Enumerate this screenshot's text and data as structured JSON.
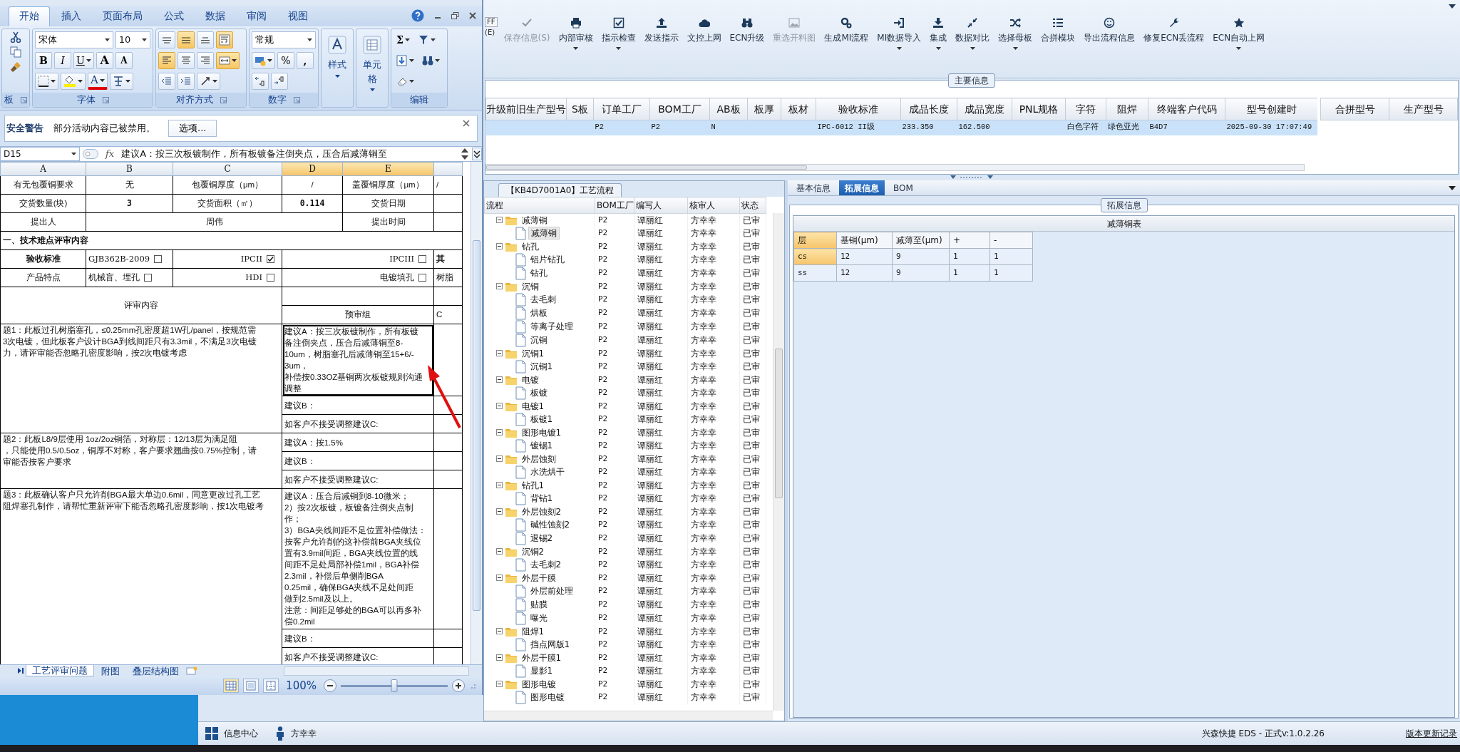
{
  "excel": {
    "tabs": [
      {
        "label": "开始",
        "selected": true
      },
      {
        "label": "插入",
        "selected": false
      },
      {
        "label": "页面布局",
        "selected": false
      },
      {
        "label": "公式",
        "selected": false
      },
      {
        "label": "数据",
        "selected": false
      },
      {
        "label": "审阅",
        "selected": false
      },
      {
        "label": "视图",
        "selected": false
      }
    ],
    "ribbon": {
      "clipboard": {
        "label": "板"
      },
      "font": {
        "label": "字体",
        "font_name": "宋体",
        "font_size": "10",
        "bold": "B",
        "italic": "I",
        "underline": "U",
        "grow": "A",
        "shrink": "A",
        "font_color": "A"
      },
      "alignment": {
        "label": "对齐方式",
        "buttons": [
          {
            "kind": "top",
            "selected": false
          },
          {
            "kind": "middle",
            "selected": true
          },
          {
            "kind": "bottom",
            "selected": false
          },
          {
            "kind": "wrap",
            "selected": true
          },
          {
            "kind": "left",
            "selected": true
          },
          {
            "kind": "center",
            "selected": false
          },
          {
            "kind": "right",
            "selected": false
          },
          {
            "kind": "merge",
            "selected": true
          },
          {
            "kind": "outdent",
            "selected": false
          },
          {
            "kind": "indent",
            "selected": false
          },
          {
            "kind": "orientation",
            "selected": false
          }
        ]
      },
      "number": {
        "label": "数字",
        "format": "常规",
        "percent": "%",
        "comma": ","
      },
      "styles": {
        "label": "样式"
      },
      "cells": {
        "label": "单元格"
      },
      "editing": {
        "label": "编辑",
        "sum": "Σ"
      }
    },
    "security_bar": {
      "title": "安全警告",
      "message": "部分活动内容已被禁用。",
      "button": "选项..."
    },
    "name_box": "D15",
    "fx": "fx",
    "formula": "建议A：按三次板镀制作，所有板镀备注倒夹点，压合后减薄铜至",
    "columns": [
      {
        "label": "A",
        "selected": false
      },
      {
        "label": "B",
        "selected": false
      },
      {
        "label": "C",
        "selected": false
      },
      {
        "label": "D",
        "selected": true
      },
      {
        "label": "E",
        "selected": true
      }
    ],
    "rows": [
      {
        "kind": "info",
        "bold_values": false,
        "cells": [
          "有无包覆铜要求",
          "无",
          "包覆铜厚度（μm）",
          "/",
          "盖覆铜厚度（μm）",
          "/"
        ]
      },
      {
        "kind": "info",
        "bold_values": true,
        "cells": [
          "交货数量(块)",
          "3",
          "交货面积（㎡）",
          "0.114",
          "交货日期"
        ]
      },
      {
        "kind": "person",
        "cells": [
          "提出人",
          "周伟",
          "提出时间"
        ]
      },
      {
        "kind": "section",
        "text": "一、技术难点评审内容"
      },
      {
        "kind": "options",
        "label": "验收标准",
        "bold": true,
        "options": [
          {
            "text": "GJB362B-2009",
            "checked": false
          },
          {
            "text": "IPCII",
            "checked": true
          },
          {
            "text": "IPCIII",
            "checked": false
          }
        ],
        "extra": "其"
      },
      {
        "kind": "options",
        "label": "产品特点",
        "bold": false,
        "options": [
          {
            "text": "机械盲、埋孔",
            "checked": false
          },
          {
            "text": "HDI",
            "checked": false
          },
          {
            "text": "电镀填孔",
            "checked": false
          }
        ],
        "extra": "树脂"
      },
      {
        "kind": "review_header",
        "left": "评审内容",
        "group": "预审组",
        "extra": "C"
      },
      {
        "kind": "issue",
        "issue_lines": [
          "题1：此板过孔树脂塞孔，≤0.25mm孔密度超1W孔/panel，按规范需",
          "3次电镀，但此板客户设计BGA到线间距只有3.3mil，不满足3次电镀",
          "力，请评审能否忽略孔密度影响，按2次电镀考虑"
        ],
        "suggestions": [
          {
            "selected": true,
            "lines": [
              "建议A：按三次板镀制作，所有板镀",
              "备注倒夹点，压合后减薄铜至8-",
              "10um，树脂塞孔后减薄铜至15+6/-",
              "3um，",
              "补偿按0.33OZ基铜两次板镀规则沟通",
              "调整"
            ]
          },
          {
            "selected": false,
            "lines": [
              "建议B："
            ]
          },
          {
            "selected": false,
            "lines": [
              "如客户不接受调整建议C:"
            ]
          }
        ]
      },
      {
        "kind": "issue",
        "issue_lines": [
          "题2：此板L8/9层使用 1oz/2oz铜箔，对称层：12/13层为满足阻",
          "，只能使用0.5/0.5oz，铜厚不对称，客户要求翘曲按0.75%控制，请",
          "审能否按客户要求"
        ],
        "suggestions": [
          {
            "selected": false,
            "lines": [
              "建议A：按1.5%"
            ]
          },
          {
            "selected": false,
            "lines": [
              "建议B："
            ]
          },
          {
            "selected": false,
            "lines": [
              "如客户不接受调整建议C:"
            ]
          }
        ]
      },
      {
        "kind": "issue",
        "issue_lines": [
          "题3：此板确认客户只允许削BGA最大单边0.6mil，同意更改过孔工艺",
          "阻焊塞孔制作，请帮忙重新评审下能否忽略孔密度影响，按1次电镀考"
        ],
        "suggestions": [
          {
            "selected": false,
            "lines": [
              "建议A：压合后减铜到8-10微米；",
              "2）按2次板镀，板镀备注倒夹点制",
              "作；",
              "3）BGA夹线间距不足位置补偿做法：",
              "按客户允许削的这补偿前BGA夹线位",
              "置有3.9mil间距，BGA夹线位置的线",
              "间距不足处局部补偿1mil，BGA补偿",
              "2.3mil，补偿后单侧削BGA",
              "0.25mil，确保BGA夹线不足处间距",
              "做到2.5mil及以上。",
              "注意：间距足够处的BGA可以再多补",
              "偿0.2mil"
            ]
          },
          {
            "selected": false,
            "lines": [
              "建议B："
            ]
          },
          {
            "selected": false,
            "lines": [
              "如客户不接受调整建议C:"
            ]
          }
        ]
      }
    ],
    "sheet_tabs": [
      {
        "label": "工艺评审问题",
        "selected": true
      },
      {
        "label": "附图",
        "selected": false
      },
      {
        "label": "叠层结构图",
        "selected": false
      }
    ],
    "zoom": {
      "label": "100%",
      "level": 0.5
    }
  },
  "toolbar": {
    "partial_button": [
      "FF",
      "(E)"
    ],
    "buttons": [
      {
        "label": "保存信息(S)",
        "disabled": true,
        "dropdown": false
      },
      {
        "label": "内部审核",
        "disabled": false,
        "dropdown": true
      },
      {
        "label": "指示检查",
        "disabled": false,
        "dropdown": true
      },
      {
        "label": "发送指示",
        "disabled": false,
        "dropdown": false
      },
      {
        "label": "文控上网",
        "disabled": false,
        "dropdown": false
      },
      {
        "label": "ECN升级",
        "disabled": false,
        "dropdown": false
      },
      {
        "label": "重选开料图",
        "disabled": true,
        "dropdown": false
      },
      {
        "label": "生成MI流程",
        "disabled": false,
        "dropdown": false
      },
      {
        "label": "MI数据导入",
        "disabled": false,
        "dropdown": true
      },
      {
        "label": "集成",
        "disabled": false,
        "dropdown": true
      },
      {
        "label": "数据对比",
        "disabled": false,
        "dropdown": true
      },
      {
        "label": "选择母板",
        "disabled": false,
        "dropdown": true
      },
      {
        "label": "合拼模块",
        "disabled": false,
        "dropdown": false
      },
      {
        "label": "导出流程信息",
        "disabled": false,
        "dropdown": false
      },
      {
        "label": "修复ECN丢流程",
        "disabled": false,
        "dropdown": false
      },
      {
        "label": "ECN自动上网",
        "disabled": false,
        "dropdown": true
      }
    ]
  },
  "main_info": {
    "title": "主要信息",
    "columns": [
      "升级前旧生产型号",
      "S板",
      "订单工厂",
      "BOM工厂",
      "AB板",
      "板厚",
      "板材",
      "验收标准",
      "成品长度",
      "成品宽度",
      "PNL规格",
      "字符",
      "阻焊",
      "终端客户代码",
      "型号创建时"
    ],
    "rows": [
      {
        "selected": true,
        "cells": [
          null,
          null,
          "P2",
          "P2",
          "N",
          null,
          null,
          "IPC-6012 II级",
          "233.350",
          "162.500",
          null,
          "白色字符",
          "绿色亚光",
          "B4D7",
          "2025-09-30 17:07:49"
        ]
      }
    ],
    "merge_columns": [
      "合拼型号",
      "生产型号"
    ]
  },
  "process": {
    "title": "【KB4D7001A0】工艺流程",
    "columns": [
      "流程",
      "BOM工厂",
      "编写人",
      "核审人",
      "状态"
    ],
    "items": [
      {
        "name": "减薄铜",
        "bom": "P2",
        "writer": "谭丽红",
        "reviewer": "方幸幸",
        "status": "已审",
        "expanded": true,
        "selected": false,
        "children": [
          {
            "name": "减薄铜",
            "bom": "P2",
            "writer": "谭丽红",
            "reviewer": "方幸幸",
            "status": "已审",
            "selected": true
          }
        ]
      },
      {
        "name": "钻孔",
        "bom": "P2",
        "writer": "谭丽红",
        "reviewer": "方幸幸",
        "status": "已审",
        "expanded": true,
        "selected": false,
        "children": [
          {
            "name": "铝片钻孔",
            "bom": "P2",
            "writer": "谭丽红",
            "reviewer": "方幸幸",
            "status": "已审",
            "selected": false
          },
          {
            "name": "钻孔",
            "bom": "P2",
            "writer": "谭丽红",
            "reviewer": "方幸幸",
            "status": "已审",
            "selected": false
          }
        ]
      },
      {
        "name": "沉铜",
        "bom": "P2",
        "writer": "谭丽红",
        "reviewer": "方幸幸",
        "status": "已审",
        "expanded": true,
        "selected": false,
        "children": [
          {
            "name": "去毛刺",
            "bom": "P2",
            "writer": "谭丽红",
            "reviewer": "方幸幸",
            "status": "已审",
            "selected": false
          },
          {
            "name": "烘板",
            "bom": "P2",
            "writer": "谭丽红",
            "reviewer": "方幸幸",
            "status": "已审",
            "selected": false
          },
          {
            "name": "等离子处理",
            "bom": "P2",
            "writer": "谭丽红",
            "reviewer": "方幸幸",
            "status": "已审",
            "selected": false
          },
          {
            "name": "沉铜",
            "bom": "P2",
            "writer": "谭丽红",
            "reviewer": "方幸幸",
            "status": "已审",
            "selected": false
          }
        ]
      },
      {
        "name": "沉铜1",
        "bom": "P2",
        "writer": "谭丽红",
        "reviewer": "方幸幸",
        "status": "已审",
        "expanded": true,
        "selected": false,
        "children": [
          {
            "name": "沉铜1",
            "bom": "P2",
            "writer": "谭丽红",
            "reviewer": "方幸幸",
            "status": "已审",
            "selected": false
          }
        ]
      },
      {
        "name": "电镀",
        "bom": "P2",
        "writer": "谭丽红",
        "reviewer": "方幸幸",
        "status": "已审",
        "expanded": true,
        "selected": false,
        "children": [
          {
            "name": "板镀",
            "bom": "P2",
            "writer": "谭丽红",
            "reviewer": "方幸幸",
            "status": "已审",
            "selected": false
          }
        ]
      },
      {
        "name": "电镀1",
        "bom": "P2",
        "writer": "谭丽红",
        "reviewer": "方幸幸",
        "status": "已审",
        "expanded": true,
        "selected": false,
        "children": [
          {
            "name": "板镀1",
            "bom": "P2",
            "writer": "谭丽红",
            "reviewer": "方幸幸",
            "status": "已审",
            "selected": false
          }
        ]
      },
      {
        "name": "图形电镀1",
        "bom": "P2",
        "writer": "谭丽红",
        "reviewer": "方幸幸",
        "status": "已审",
        "expanded": true,
        "selected": false,
        "children": [
          {
            "name": "镀锡1",
            "bom": "P2",
            "writer": "谭丽红",
            "reviewer": "方幸幸",
            "status": "已审",
            "selected": false
          }
        ]
      },
      {
        "name": "外层蚀刻",
        "bom": "P2",
        "writer": "谭丽红",
        "reviewer": "方幸幸",
        "status": "已审",
        "expanded": true,
        "selected": false,
        "children": [
          {
            "name": "水洗烘干",
            "bom": "P2",
            "writer": "谭丽红",
            "reviewer": "方幸幸",
            "status": "已审",
            "selected": false
          }
        ]
      },
      {
        "name": "钻孔1",
        "bom": "P2",
        "writer": "谭丽红",
        "reviewer": "方幸幸",
        "status": "已审",
        "expanded": true,
        "selected": false,
        "children": [
          {
            "name": "背钻1",
            "bom": "P2",
            "writer": "谭丽红",
            "reviewer": "方幸幸",
            "status": "已审",
            "selected": false
          }
        ]
      },
      {
        "name": "外层蚀刻2",
        "bom": "P2",
        "writer": "谭丽红",
        "reviewer": "方幸幸",
        "status": "已审",
        "expanded": true,
        "selected": false,
        "children": [
          {
            "name": "碱性蚀刻2",
            "bom": "P2",
            "writer": "谭丽红",
            "reviewer": "方幸幸",
            "status": "已审",
            "selected": false
          },
          {
            "name": "退锡2",
            "bom": "P2",
            "writer": "谭丽红",
            "reviewer": "方幸幸",
            "status": "已审",
            "selected": false
          }
        ]
      },
      {
        "name": "沉铜2",
        "bom": "P2",
        "writer": "谭丽红",
        "reviewer": "方幸幸",
        "status": "已审",
        "expanded": true,
        "selected": false,
        "children": [
          {
            "name": "去毛刺2",
            "bom": "P2",
            "writer": "谭丽红",
            "reviewer": "方幸幸",
            "status": "已审",
            "selected": false
          }
        ]
      },
      {
        "name": "外层干膜",
        "bom": "P2",
        "writer": "谭丽红",
        "reviewer": "方幸幸",
        "status": "已审",
        "expanded": true,
        "selected": false,
        "children": [
          {
            "name": "外层前处理",
            "bom": "P2",
            "writer": "谭丽红",
            "reviewer": "方幸幸",
            "status": "已审",
            "selected": false
          },
          {
            "name": "贴膜",
            "bom": "P2",
            "writer": "谭丽红",
            "reviewer": "方幸幸",
            "status": "已审",
            "selected": false
          },
          {
            "name": "曝光",
            "bom": "P2",
            "writer": "谭丽红",
            "reviewer": "方幸幸",
            "status": "已审",
            "selected": false
          }
        ]
      },
      {
        "name": "阻焊1",
        "bom": "P2",
        "writer": "谭丽红",
        "reviewer": "方幸幸",
        "status": "已审",
        "expanded": true,
        "selected": false,
        "children": [
          {
            "name": "挡点网版1",
            "bom": "P2",
            "writer": "谭丽红",
            "reviewer": "方幸幸",
            "status": "已审",
            "selected": false
          }
        ]
      },
      {
        "name": "外层干膜1",
        "bom": "P2",
        "writer": "谭丽红",
        "reviewer": "方幸幸",
        "status": "已审",
        "expanded": true,
        "selected": false,
        "children": [
          {
            "name": "显影1",
            "bom": "P2",
            "writer": "谭丽红",
            "reviewer": "方幸幸",
            "status": "已审",
            "selected": false
          }
        ]
      },
      {
        "name": "图形电镀",
        "bom": "P2",
        "writer": "谭丽红",
        "reviewer": "方幸幸",
        "status": "已审",
        "expanded": true,
        "selected": false,
        "children": [
          {
            "name": "图形电镀",
            "bom": "P2",
            "writer": "谭丽红",
            "reviewer": "方幸幸",
            "status": "已审",
            "selected": false
          }
        ]
      }
    ]
  },
  "detail_tabs": [
    {
      "label": "基本信息",
      "selected": false
    },
    {
      "label": "拓展信息",
      "selected": true
    },
    {
      "label": "BOM",
      "selected": false
    }
  ],
  "extension": {
    "title": "拓展信息",
    "table": {
      "title": "减薄铜表",
      "columns": [
        "层",
        "基铜(μm)",
        "减薄至(μm)",
        "+",
        "-"
      ],
      "rows": [
        {
          "selected": true,
          "cells": [
            "cs",
            "12",
            "9",
            "1",
            "1"
          ]
        },
        {
          "selected": false,
          "cells": [
            "ss",
            "12",
            "9",
            "1",
            "1"
          ]
        }
      ]
    }
  },
  "status_bar": {
    "items": [
      {
        "kind": "apps",
        "label": "信息中心"
      },
      {
        "kind": "user",
        "label": "方幸幸"
      }
    ],
    "version": "兴森快捷 EDS - 正式v:1.0.2.26",
    "link": "版本更新记录"
  }
}
